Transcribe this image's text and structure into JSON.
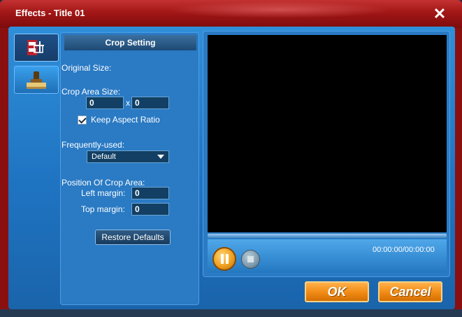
{
  "window": {
    "title": "Effects - Title 01",
    "close_glyph": "✕"
  },
  "tabs": [
    {
      "icon": "crop-film-icon"
    },
    {
      "icon": "stamp-icon"
    }
  ],
  "panel": {
    "header": "Crop Setting",
    "original_size_label": "Original Size:",
    "crop_area_label": "Crop Area Size:",
    "crop_width": "0",
    "crop_x_sep": "x",
    "crop_height": "0",
    "keep_aspect_label": "Keep Aspect Ratio",
    "keep_aspect_checked": true,
    "frequently_used_label": "Frequently-used:",
    "frequently_used_value": "Default",
    "position_label": "Position Of Crop Area:",
    "left_margin_label": "Left margin:",
    "left_margin_value": "0",
    "top_margin_label": "Top margin:",
    "top_margin_value": "0",
    "restore_label": "Restore Defaults"
  },
  "preview": {
    "time": "00:00:00/00:00:00",
    "play_state": "pause-icon",
    "stop_icon": "stop-icon"
  },
  "buttons": {
    "ok": "OK",
    "cancel": "Cancel"
  },
  "colors": {
    "titlebar": "#a21616",
    "client": "#1f74c2",
    "accent_button": "#f08a14"
  }
}
